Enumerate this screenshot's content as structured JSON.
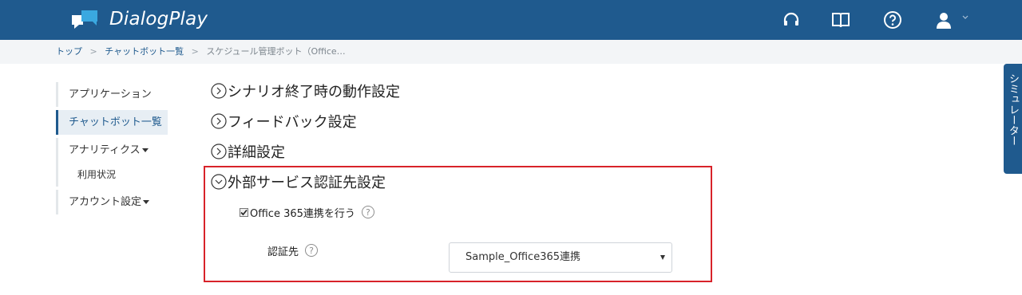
{
  "header": {
    "brand": "DialogPlay",
    "icons": [
      "logo-icon",
      "headset-icon",
      "book-icon",
      "help-icon",
      "user-icon",
      "chevron-down-icon"
    ],
    "bg_color": "#1f5a8e"
  },
  "breadcrumb": {
    "items": [
      "トップ",
      "チャットボット一覧",
      "スケジュール管理ボット（Office…"
    ],
    "separator": ">"
  },
  "sidebar": {
    "items": [
      {
        "label": "アプリケーション"
      },
      {
        "label": "チャットボット一覧",
        "active": true
      },
      {
        "label": "アナリティクス"
      },
      {
        "label": "利用状況"
      },
      {
        "label": "アカウント設定"
      }
    ]
  },
  "sections": [
    {
      "title": "シナリオ終了時の動作設定",
      "expanded": false
    },
    {
      "title": "フィードバック設定",
      "expanded": false
    },
    {
      "title": "詳細設定",
      "expanded": false
    },
    {
      "title": "外部サービス認証先設定",
      "expanded": true
    }
  ],
  "external_auth": {
    "checkbox_label": "Office 365連携を行う",
    "checked": true,
    "auth_label": "認証先",
    "help_glyph": "?",
    "select_value": "Sample_Office365連携",
    "highlight_color": "#d8232a"
  },
  "simulator_tab": {
    "label": "シミュレーター"
  }
}
